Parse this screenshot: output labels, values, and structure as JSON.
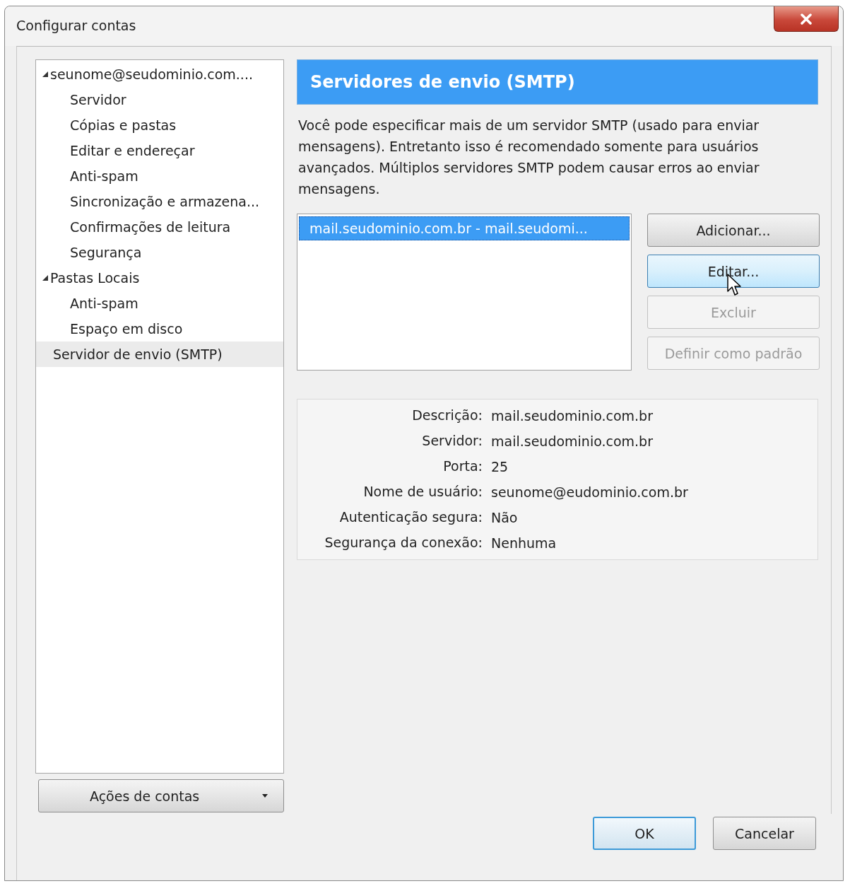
{
  "window": {
    "title": "Configurar contas"
  },
  "tree": [
    {
      "label": "seunome@seudominio.com....",
      "expanded": true,
      "selected": false,
      "children": [
        {
          "label": "Servidor",
          "selected": false
        },
        {
          "label": "Cópias e pastas",
          "selected": false
        },
        {
          "label": "Editar e endereçar",
          "selected": false
        },
        {
          "label": "Anti-spam",
          "selected": false
        },
        {
          "label": "Sincronização e armazena...",
          "selected": false
        },
        {
          "label": "Confirmações de leitura",
          "selected": false
        },
        {
          "label": "Segurança",
          "selected": false
        }
      ]
    },
    {
      "label": "Pastas Locais",
      "expanded": true,
      "selected": false,
      "children": [
        {
          "label": "Anti-spam",
          "selected": false
        },
        {
          "label": "Espaço em disco",
          "selected": false
        }
      ]
    },
    {
      "label": "Servidor de envio (SMTP)",
      "selected": true
    }
  ],
  "account_actions": {
    "label": "Ações de contas"
  },
  "panel": {
    "title": "Servidores de envio (SMTP)",
    "description": "Você pode especificar mais de um servidor SMTP (usado para enviar mensagens). Entretanto isso é recomendado somente para usuários avançados. Múltiplos servidores SMTP podem causar erros ao enviar mensagens.",
    "servers": [
      {
        "label": "mail.seudominio.com.br - mail.seudomi...",
        "selected": true
      }
    ],
    "buttons": [
      {
        "label": "Adicionar...",
        "disabled": false,
        "hovered": false
      },
      {
        "label": "Editar...",
        "disabled": false,
        "hovered": true
      },
      {
        "label": "Excluir",
        "disabled": true,
        "hovered": false
      },
      {
        "label": "Definir como padrão",
        "disabled": true,
        "hovered": false
      }
    ],
    "details": [
      {
        "label": "Descrição:",
        "value": "mail.seudominio.com.br"
      },
      {
        "label": "Servidor:",
        "value": "mail.seudominio.com.br"
      },
      {
        "label": "Porta:",
        "value": "25"
      },
      {
        "label": "Nome de usuário:",
        "value": "seunome@eudominio.com.br"
      },
      {
        "label": "Autenticação segura:",
        "value": "Não"
      },
      {
        "label": "Segurança da conexão:",
        "value": "Nenhuma"
      }
    ]
  },
  "dialog_buttons": [
    {
      "label": "OK",
      "default": true
    },
    {
      "label": "Cancelar",
      "default": false
    }
  ]
}
